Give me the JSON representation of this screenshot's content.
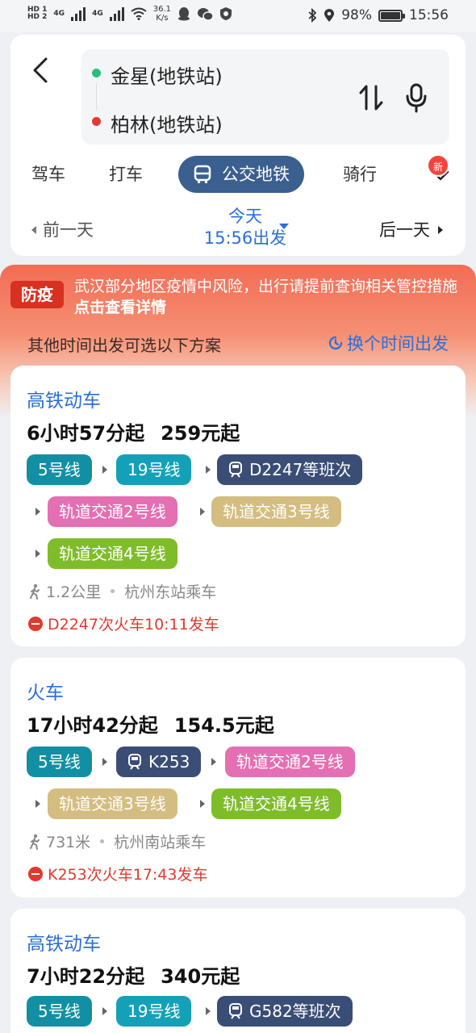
{
  "status_bar": {
    "hd1": "HD 1",
    "hd2": "HD 2",
    "net1": "4G",
    "net2": "4G",
    "speed": "36.1",
    "speed_unit": "K/s",
    "battery": "98%",
    "battery_level": 0.98,
    "time": "15:56"
  },
  "search": {
    "origin": "金星(地铁站)",
    "destination": "柏林(地铁站)",
    "origin_color": "#27c17a",
    "destination_color": "#e53935"
  },
  "modes": [
    {
      "label": "驾车"
    },
    {
      "label": "打车"
    },
    {
      "label": "公交地铁"
    },
    {
      "label": "骑行"
    }
  ],
  "new_badge": "新",
  "day_nav": {
    "prev": "前一天",
    "today": "今天",
    "depart": "15:56出发",
    "next": "后一天"
  },
  "banner": {
    "tag": "防疫",
    "text": "武汉部分地区疫情中风险，出行请提前查询相关管控措施",
    "link": "点击查看详情",
    "alt_text": "其他时间出发可选以下方案",
    "change_time": "换个时间出发"
  },
  "cards": [
    {
      "title": "高铁动车",
      "duration": "6小时57分起",
      "price": "259元起",
      "pills": [
        "5号线",
        "19号线",
        "D2247等班次",
        "轨道交通2号线",
        "轨道交通3号线",
        "轨道交通4号线"
      ],
      "walk": "1.2公里",
      "station": "杭州东站乘车",
      "warn": "D2247次火车10:11发车"
    },
    {
      "title": "火车",
      "duration": "17小时42分起",
      "price": "154.5元起",
      "pills": [
        "5号线",
        "K253",
        "轨道交通2号线",
        "轨道交通3号线",
        "轨道交通4号线"
      ],
      "walk": "731米",
      "station": "杭州南站乘车",
      "warn": "K253次火车17:43发车"
    },
    {
      "title": "高铁动车",
      "duration": "7小时22分起",
      "price": "340元起",
      "pills": [
        "5号线",
        "19号线",
        "G582等班次"
      ]
    }
  ],
  "colors": {
    "line5": "#138fa3",
    "line19": "#14a1b8",
    "train": "#3a4d75",
    "rail2": "#e46fb2",
    "rail3": "#d4bd80",
    "rail4": "#7fbc2a",
    "accent": "#2b6fd6"
  }
}
